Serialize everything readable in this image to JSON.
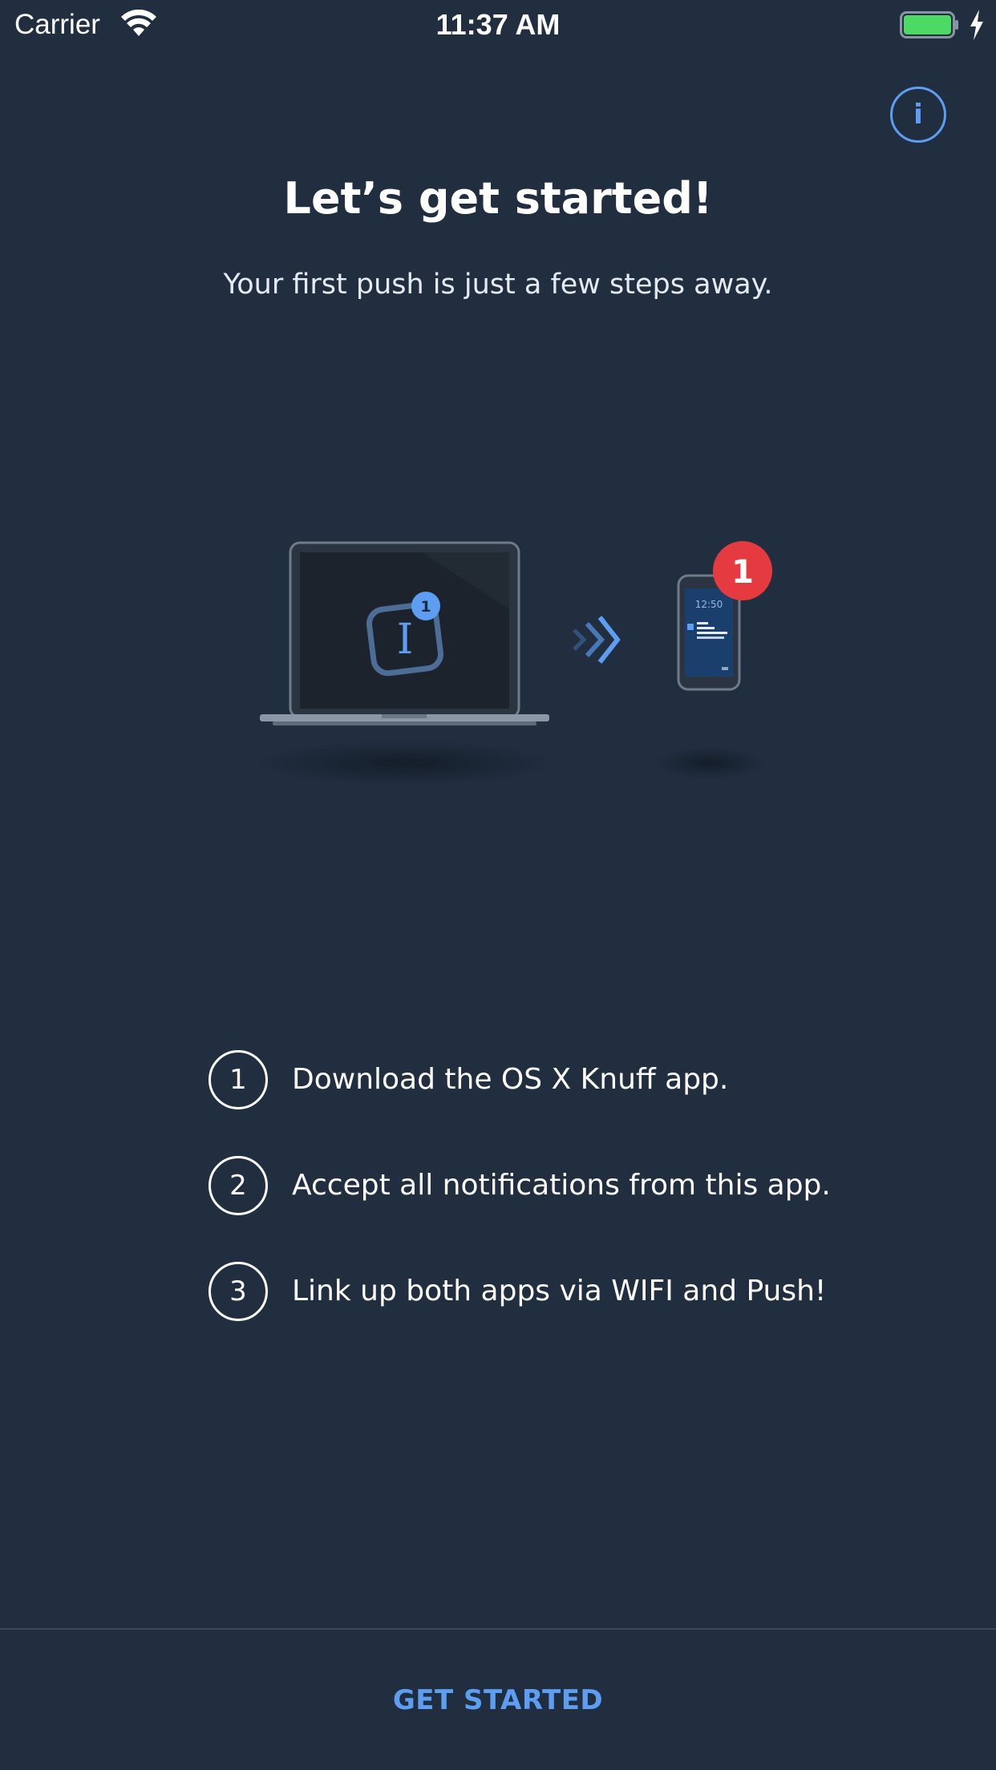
{
  "status_bar": {
    "carrier": "Carrier",
    "time": "11:37 AM"
  },
  "onboarding": {
    "title": "Let’s get started!",
    "subtitle": "Your first push is just a few steps away.",
    "info_label": "i",
    "illustration": {
      "mac_badge": "1",
      "phone_badge": "1",
      "phone_time": "12:50"
    },
    "steps": [
      {
        "number": "1",
        "text": "Download the OS X Knuff app."
      },
      {
        "number": "2",
        "text": "Accept all notifications from this app."
      },
      {
        "number": "3",
        "text": "Link up both apps via WIFI and Push!"
      }
    ],
    "cta_label": "GET STARTED"
  },
  "colors": {
    "background": "#202e40",
    "accent": "#5d9ef3",
    "badge_red": "#e53a3f",
    "battery_green": "#4cd964"
  },
  "icons": [
    "wifi-icon",
    "battery-icon",
    "charging-bolt-icon",
    "info-icon",
    "laptop-icon",
    "phone-icon",
    "double-chevron-icon"
  ]
}
